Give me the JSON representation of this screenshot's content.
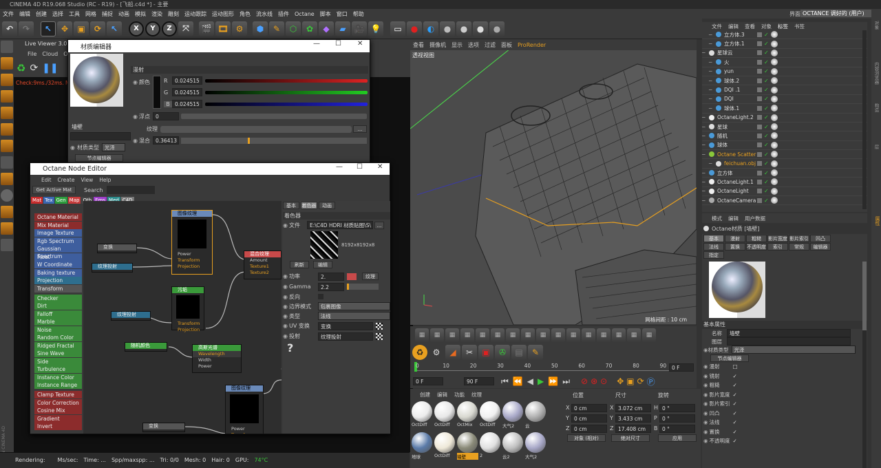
{
  "app": {
    "title": "CINEMA 4D R19.068 Studio (RC - R19) - [飞船.c4d *] - 主要",
    "interface_label": "界面:",
    "interface_value": "OCTANCE 调好的 (用户)"
  },
  "menu": [
    "文件",
    "编辑",
    "创建",
    "选择",
    "工具",
    "网格",
    "捕捉",
    "动画",
    "模拟",
    "渲染",
    "雕刻",
    "运动跟踪",
    "运动图形",
    "角色",
    "流水线",
    "插件",
    "Octane",
    "脚本",
    "窗口",
    "帮助"
  ],
  "toolbar": {
    "x": "X",
    "y": "Y",
    "z": "Z"
  },
  "live_viewer": {
    "title": "Live Viewer 3.07-",
    "menu": [
      "File",
      "Cloud",
      "Ob"
    ],
    "check_text": "Check:9ms./32ms. Me"
  },
  "material_editor": {
    "title": "材质编辑器",
    "section": "漫射",
    "color_label": "颜色",
    "r_label": "R",
    "g_label": "G",
    "b_label": "B",
    "r_value": "0.024515",
    "g_value": "0.024515",
    "b_value": "0.024515",
    "float_label": "浮点",
    "float_value": "0",
    "texture_label": "纹理",
    "mix_label": "混合",
    "mix_value": "0.36413",
    "mat_name": "墙壁",
    "mat_type_label": "材质类型",
    "mat_type_value": "光泽",
    "node_btn": "节点编辑器"
  },
  "node_editor": {
    "title": "Octane Node Editor",
    "menu": [
      "Edit",
      "Create",
      "View",
      "Help"
    ],
    "get_active": "Get Active Mat",
    "search_label": "Search",
    "cat_tabs": [
      {
        "t": "Mat",
        "c": "#c62c2c"
      },
      {
        "t": "Tex",
        "c": "#3a66b0"
      },
      {
        "t": "Gen",
        "c": "#2c9c3c"
      },
      {
        "t": "Map",
        "c": "#c63c3c"
      },
      {
        "t": "Oth",
        "c": "#444"
      },
      {
        "t": "Ems",
        "c": "#9c3cc6"
      },
      {
        "t": "Med",
        "c": "#2c8c8c"
      },
      {
        "t": "C4D",
        "c": "#777"
      }
    ],
    "list": [
      {
        "t": "Octane Material",
        "c": "#8c2c2c"
      },
      {
        "t": "Mix Material",
        "c": "#8c2c2c"
      },
      {
        "t": "Image Texture",
        "c": "#3e5e9e"
      },
      {
        "t": "Rgb Spectrum",
        "c": "#3e5e9e"
      },
      {
        "t": "Gaussian Spectrum",
        "c": "#3e5e9e"
      },
      {
        "t": "Float",
        "c": "#3e5e9e"
      },
      {
        "t": "W Coordinate",
        "c": "#3e5e9e"
      },
      {
        "t": "Baking texture",
        "c": "#3e5e9e"
      },
      {
        "t": "Projection",
        "c": "#2e6e8e"
      },
      {
        "t": "Transform",
        "c": "#555"
      },
      {
        "t": "Checker",
        "c": "#3a8a3a"
      },
      {
        "t": "Dirt",
        "c": "#3a8a3a"
      },
      {
        "t": "Falloff",
        "c": "#3a8a3a"
      },
      {
        "t": "Marble",
        "c": "#3a8a3a"
      },
      {
        "t": "Noise",
        "c": "#3a8a3a"
      },
      {
        "t": "Random Color",
        "c": "#3a8a3a"
      },
      {
        "t": "Ridged Fractal",
        "c": "#3a8a3a"
      },
      {
        "t": "Sine Wave",
        "c": "#3a8a3a"
      },
      {
        "t": "Side",
        "c": "#3a8a3a"
      },
      {
        "t": "Turbulence",
        "c": "#3a8a3a"
      },
      {
        "t": "Instance Color",
        "c": "#3a8a3a"
      },
      {
        "t": "Instance Range",
        "c": "#3a8a3a"
      },
      {
        "t": "Clamp Texture",
        "c": "#8c2c2c"
      },
      {
        "t": "Color Correction",
        "c": "#8c2c2c"
      },
      {
        "t": "Cosine Mix",
        "c": "#8c2c2c"
      },
      {
        "t": "Gradient",
        "c": "#8c2c2c"
      },
      {
        "t": "Invert",
        "c": "#8c2c2c"
      }
    ],
    "nodes": {
      "img1": "图像纹理",
      "img2": "图像纹理",
      "mix": "混合纹理",
      "transform1": "变换",
      "transform2": "变换",
      "proj1": "纹理投射",
      "proj2": "纹理投射",
      "dirt": "污垢",
      "rand": "随机颜色",
      "gauss": "高斯光谱",
      "ports_img": [
        "Power",
        "Transform",
        "Projection"
      ],
      "ports_mix": [
        "Amount",
        "Texture1",
        "Texture2"
      ],
      "ports_dirt": [
        "Transform",
        "Projection"
      ],
      "ports_gauss": [
        "Wavelength",
        "Width",
        "Power"
      ]
    },
    "right_tabs": [
      "基本",
      "着色器",
      "动画"
    ],
    "shader_title": "着色器",
    "file_label": "文件",
    "file_path": "E:\\C4D HDRI 材质贴图\\S\\",
    "res": "8192x8192x8",
    "refresh": "刷新",
    "edit": "编辑",
    "power_label": "功率",
    "power_value": "2.",
    "texture_btn": "纹理",
    "gamma_label": "Gamma",
    "gamma_value": "2.2",
    "invert_label": "反向",
    "border_label": "边界模式",
    "border_value": "包裹图像",
    "type_label": "类型",
    "type_value": "法线",
    "uv_label": "UV 变换",
    "uv_value": "变换",
    "proj_label": "投射",
    "proj_value": "纹理投射",
    "question": "?"
  },
  "viewport": {
    "menu": [
      "查看",
      "摄像机",
      "显示",
      "选项",
      "过滤",
      "面板",
      "ProRender"
    ],
    "label": "透视视图",
    "grid_label": "网格间距 : 10 cm"
  },
  "timeline": {
    "ticks": [
      "0",
      "10",
      "20",
      "30",
      "40",
      "50",
      "60",
      "70",
      "80",
      "90"
    ],
    "end_frame": "0 F",
    "cur_frame": "0 F",
    "max_frame": "90 F"
  },
  "obj_manager": {
    "menu": [
      "文件",
      "编辑",
      "查看",
      "对象",
      "标签",
      "书签"
    ],
    "rows": [
      {
        "n": "立方体.3",
        "d": 1,
        "ic": "#4a9ad8"
      },
      {
        "n": "立方体.1",
        "d": 1,
        "ic": "#4a9ad8"
      },
      {
        "n": "星球云",
        "d": 0,
        "ic": "#ddd"
      },
      {
        "n": "火",
        "d": 1,
        "ic": "#4a9ad8"
      },
      {
        "n": "yun",
        "d": 1,
        "ic": "#4a9ad8"
      },
      {
        "n": "球体.2",
        "d": 1,
        "ic": "#4a9ad8"
      },
      {
        "n": "DQI .1",
        "d": 1,
        "ic": "#4a9ad8"
      },
      {
        "n": "DQI",
        "d": 1,
        "ic": "#4a9ad8"
      },
      {
        "n": "球体.1",
        "d": 1,
        "ic": "#4a9ad8"
      },
      {
        "n": "OctaneLight.2",
        "d": 0,
        "ic": "#eee"
      },
      {
        "n": "星球",
        "d": 0,
        "ic": "#ddd"
      },
      {
        "n": "随机",
        "d": 0,
        "ic": "#4a9ad8"
      },
      {
        "n": "球体",
        "d": 0,
        "ic": "#4a9ad8"
      },
      {
        "n": "Octane Scatter",
        "d": 0,
        "ic": "#8ac83a",
        "hl": "#e8a020"
      },
      {
        "n": "feichuan.obj",
        "d": 1,
        "ic": "#ddd",
        "hl": "#e8a020"
      },
      {
        "n": "立方体",
        "d": 0,
        "ic": "#4a9ad8"
      },
      {
        "n": "OctaneLight.1",
        "d": 0,
        "ic": "#eee"
      },
      {
        "n": "OctaneLight",
        "d": 0,
        "ic": "#eee"
      },
      {
        "n": "OctaneCamera",
        "d": 0,
        "ic": "#aaa"
      }
    ]
  },
  "attr_manager": {
    "menu": [
      "模式",
      "编辑",
      "用户数据"
    ],
    "title": "Octane材质 [墙壁]",
    "tabs1": [
      "基本",
      "漫射",
      "粗糙",
      "影片宽度",
      "影片索引",
      "凹凸"
    ],
    "tabs2": [
      "法线",
      "置换",
      "不透明度",
      "索引",
      "常规",
      "编辑器"
    ],
    "tabs3": [
      "指定"
    ],
    "basic": "基本属性",
    "name_label": "名称",
    "name_value": "墙壁",
    "layer_label": "图层",
    "type_label": "材质类型",
    "type_value": "光泽",
    "node_btn": "节点编辑器",
    "channels": [
      "漫射",
      "镜射",
      "粗糙",
      "影片宽度",
      "影片索引",
      "凹凸",
      "法线",
      "置换",
      "不透明度"
    ]
  },
  "mat_manager": {
    "menu": [
      "创建",
      "编辑",
      "功能",
      "纹理"
    ],
    "items": [
      {
        "n": "OctDiff",
        "c": "#ececec"
      },
      {
        "n": "OctDiff",
        "c": "#e8e8e8"
      },
      {
        "n": "OctMix",
        "c": "#d8d8d0"
      },
      {
        "n": "OctDiff",
        "c": "#f0f0f0"
      },
      {
        "n": "大气2",
        "c": "#a8a8c8"
      },
      {
        "n": "云",
        "c": "#b0b0b0"
      },
      {
        "n": "地球",
        "c": "#5a7aa8"
      },
      {
        "n": "OctDiff",
        "c": "#eee8d8"
      },
      {
        "n": "墙壁",
        "c": "#8a8a78"
      },
      {
        "n": "2",
        "c": "#e0e0e0"
      },
      {
        "n": "云2",
        "c": "#c0c0c0"
      },
      {
        "n": "大气2",
        "c": "#a8a8c8"
      }
    ]
  },
  "coords": {
    "pos": "位置",
    "size": "尺寸",
    "rot": "旋转",
    "x": "X",
    "y": "Y",
    "z": "Z",
    "px": "0 cm",
    "py": "0 cm",
    "pz": "0 cm",
    "sx": "3.072 cm",
    "sy": "3.433 cm",
    "sz": "17.408 cm",
    "h": "H",
    "p": "P",
    "b": "B",
    "rh": "0 °",
    "rp": "0 °",
    "rb": "0 °",
    "mode1": "对象 (相对)",
    "mode2": "绝对尺寸",
    "apply": "应用"
  },
  "status": {
    "rendering": "Rendering:",
    "mssec": "Ms/sec:",
    "time": "Time: ...",
    "spp": "Spp/maxspp: ...",
    "tri": "Tri: 0/0",
    "mesh": "Mesh: 0",
    "hair": "Hair: 0",
    "gpu": "GPU:",
    "temp": "74°C"
  },
  "side_labels": [
    "对象",
    "内容浏览器",
    "构造",
    "层"
  ],
  "attr_side": "属性",
  "brand": "MAXON CINEMA 4D"
}
